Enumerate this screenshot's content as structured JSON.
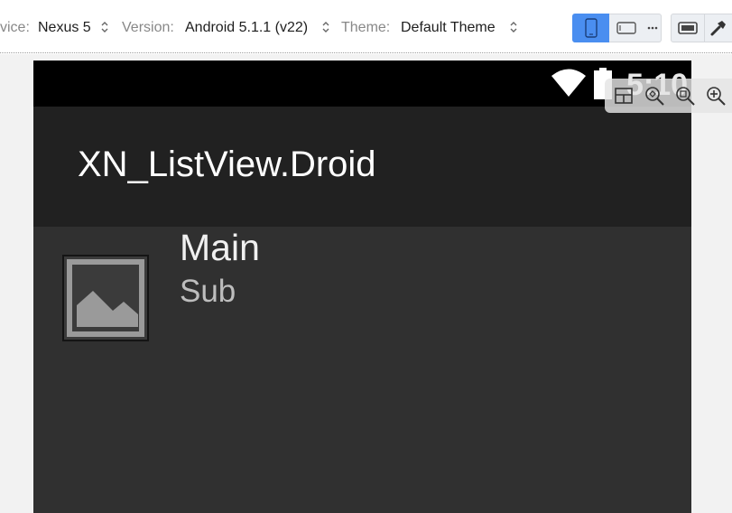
{
  "toolbar": {
    "device_label": "vice:",
    "device_value": "Nexus 5",
    "version_label": "Version:",
    "version_value": "Android 5.1.1 (v22)",
    "theme_label": "Theme:",
    "theme_value": "Default Theme",
    "accent_color": "#4a8ef0"
  },
  "device": {
    "status_time": "5:10",
    "app_title": "XN_ListView.Droid",
    "list_item": {
      "main": "Main",
      "sub": "Sub"
    },
    "colors": {
      "statusbar": "#000000",
      "actionbar": "#212121",
      "background": "#303030"
    }
  }
}
